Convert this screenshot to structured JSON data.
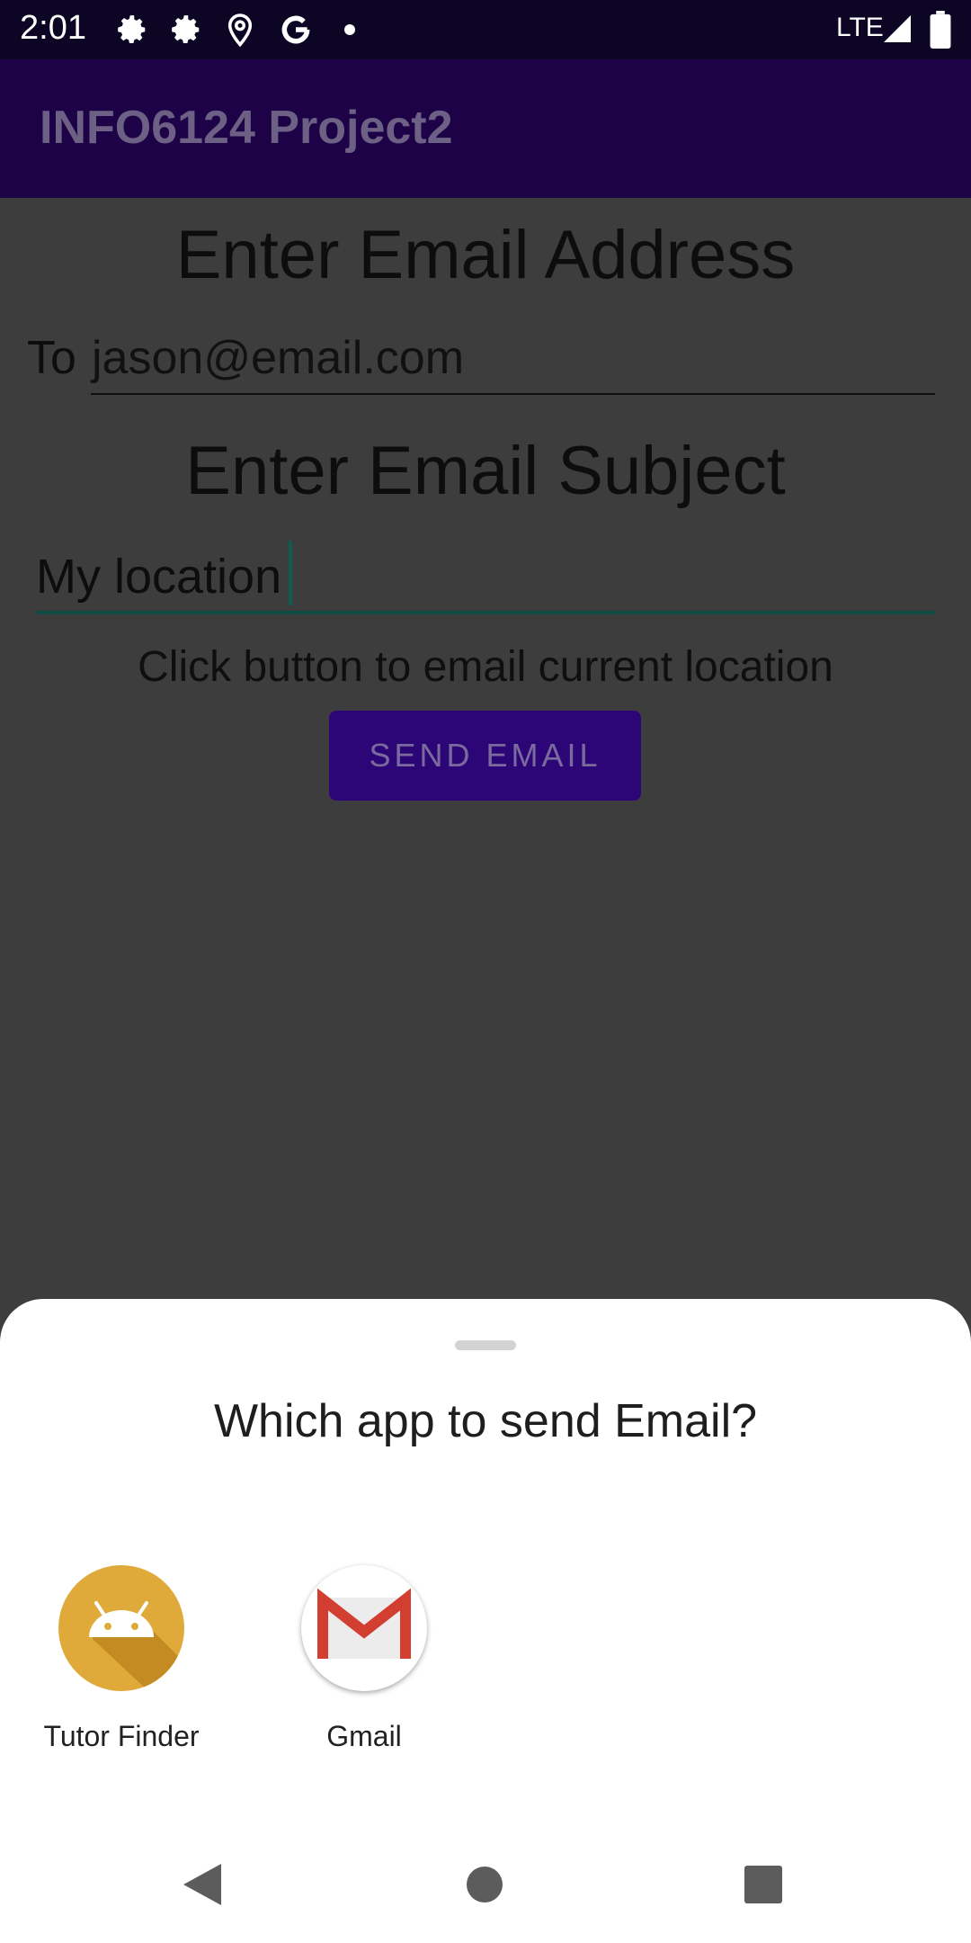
{
  "status_bar": {
    "time": "2:01",
    "network": "LTE"
  },
  "app_bar": {
    "title": "INFO6124 Project2"
  },
  "form": {
    "email_heading": "Enter Email Address",
    "to_label": "To",
    "to_value": "jason@email.com",
    "subject_heading": "Enter Email Subject",
    "subject_value": "My location",
    "hint": "Click button to email current location",
    "send_label": "SEND EMAIL"
  },
  "chooser": {
    "title": "Which app to send Email?",
    "apps": [
      {
        "label": "Tutor Finder",
        "icon": "android-icon"
      },
      {
        "label": "Gmail",
        "icon": "gmail-icon"
      }
    ]
  },
  "colors": {
    "app_bar": "#1e0248",
    "accent": "#2c0577",
    "cursor": "#0f5c52",
    "android_icon": "#e0aa3a",
    "gmail_red": "#d23f31"
  }
}
